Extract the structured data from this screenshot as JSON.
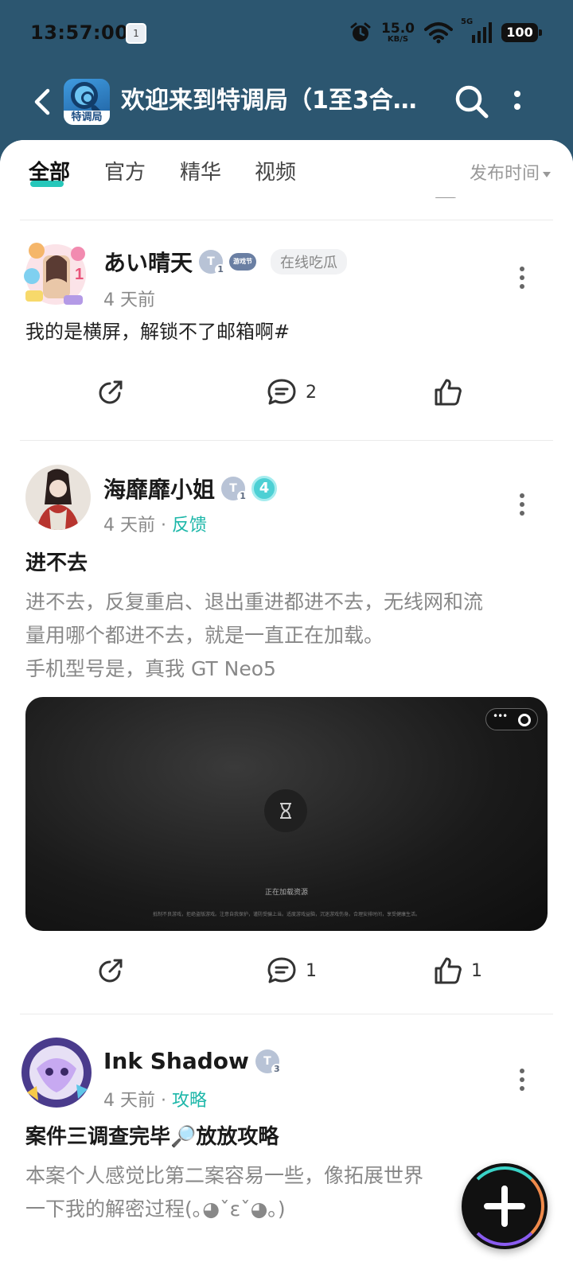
{
  "status_bar": {
    "time": "13:57:00",
    "calendar_day": "1",
    "net_speed_value": "15.0",
    "net_speed_unit": "KB/S",
    "network": "5G",
    "battery": "100"
  },
  "header": {
    "app_logo_text": "特调局",
    "title": "欢迎来到特调局（1至3合…"
  },
  "tabs": {
    "items": [
      "全部",
      "官方",
      "精华",
      "视频"
    ],
    "active": "全部",
    "sort_label": "发布时间"
  },
  "posts": [
    {
      "username": "あい晴天",
      "level": "T",
      "level_num": "1",
      "medal": "游戏节",
      "tag": "在线吃瓜",
      "time": "4 天前",
      "text": "我的是横屏，解锁不了邮箱啊#",
      "comments": "2",
      "likes": ""
    },
    {
      "username": "海靡靡小姐",
      "level": "T",
      "level_num": "1",
      "badge": "4",
      "time": "4 天前",
      "category": "反馈",
      "title": "进不去",
      "body": [
        "进不去，反复重启、退出重进都进不去，无线网和流",
        "量用哪个都进不去，就是一直正在加载。",
        "手机型号是，真我 GT Neo5"
      ],
      "video_loading_text": "正在加载资源",
      "video_notice": "抵制不良游戏，拒绝盗版游戏。注意自我保护，谨防受骗上当。适度游戏益脑，沉迷游戏伤身。合理安排时间，享受健康生活。",
      "comments": "1",
      "likes": "1"
    },
    {
      "username": "Ink Shadow",
      "level": "T",
      "level_num": "3",
      "time": "4 天前",
      "category": "攻略",
      "title": "案件三调查完毕🔎放放攻略",
      "body": [
        "本案个人感觉比第二案容易一些，像拓展世界",
        "一下我的解密过程(｡◕ˇεˇ◕｡)"
      ]
    }
  ],
  "fab": {
    "icon": "plus-icon"
  }
}
